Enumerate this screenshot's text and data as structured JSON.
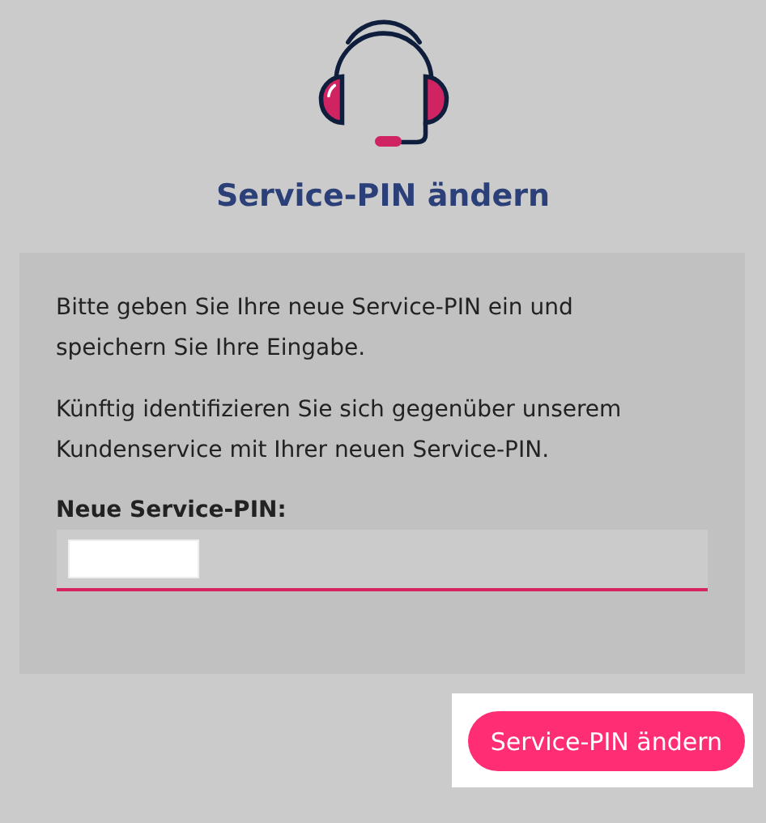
{
  "title": "Service-PIN ändern",
  "card": {
    "paragraphs": [
      "Bitte geben Sie Ihre neue Service-PIN ein und speichern Sie Ihre Eingabe.",
      "Künftig identifizieren Sie sich gegenüber unserem Kundenservice mit Ihrer neuen Service-PIN."
    ],
    "field": {
      "label": "Neue Service-PIN:"
    }
  },
  "button": "Service-PIN ändern"
}
